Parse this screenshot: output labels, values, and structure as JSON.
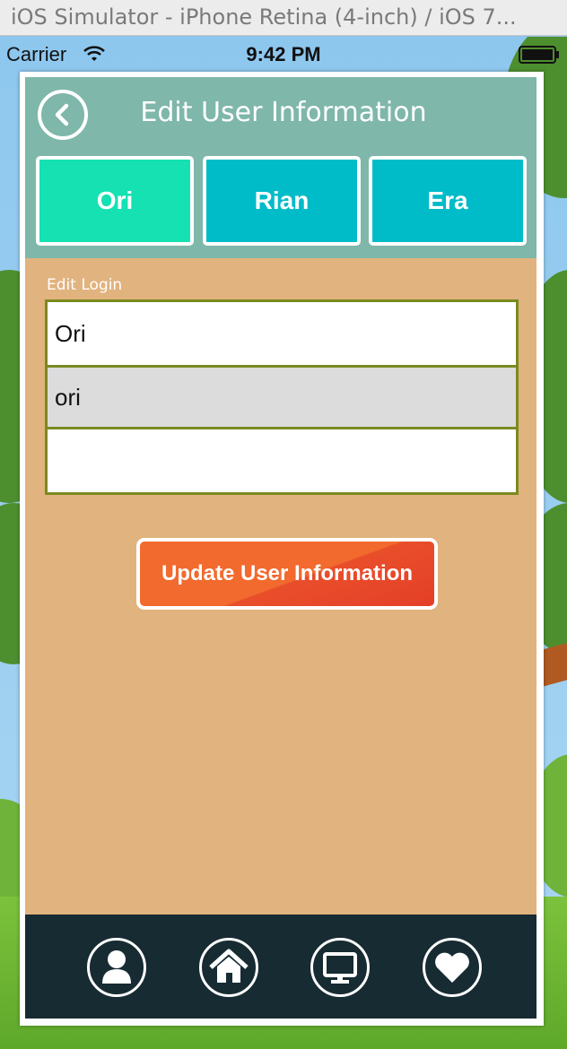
{
  "simulator": {
    "title": "iOS Simulator - iPhone Retina (4-inch) / iOS 7..."
  },
  "status_bar": {
    "carrier": "Carrier",
    "time": "9:42 PM"
  },
  "header": {
    "title": "Edit User Information",
    "back_icon": "chevron-left-circle-icon"
  },
  "tabs": [
    {
      "label": "Ori",
      "active": true
    },
    {
      "label": "Rian",
      "active": false
    },
    {
      "label": "Era",
      "active": false
    }
  ],
  "form": {
    "section_label": "Edit Login",
    "fields": [
      {
        "value": "Ori"
      },
      {
        "value": "ori"
      },
      {
        "value": ""
      }
    ]
  },
  "update_button": {
    "label": "Update User Information"
  },
  "bottom_nav": [
    {
      "icon": "user-icon"
    },
    {
      "icon": "home-icon"
    },
    {
      "icon": "monitor-icon"
    },
    {
      "icon": "heart-icon"
    }
  ],
  "colors": {
    "header": "#7fb7aa",
    "tab": "#00bcc8",
    "tab_active": "#15e1b2",
    "body": "#e1b37e",
    "button": "#f26a2e",
    "nav": "#172b33"
  }
}
